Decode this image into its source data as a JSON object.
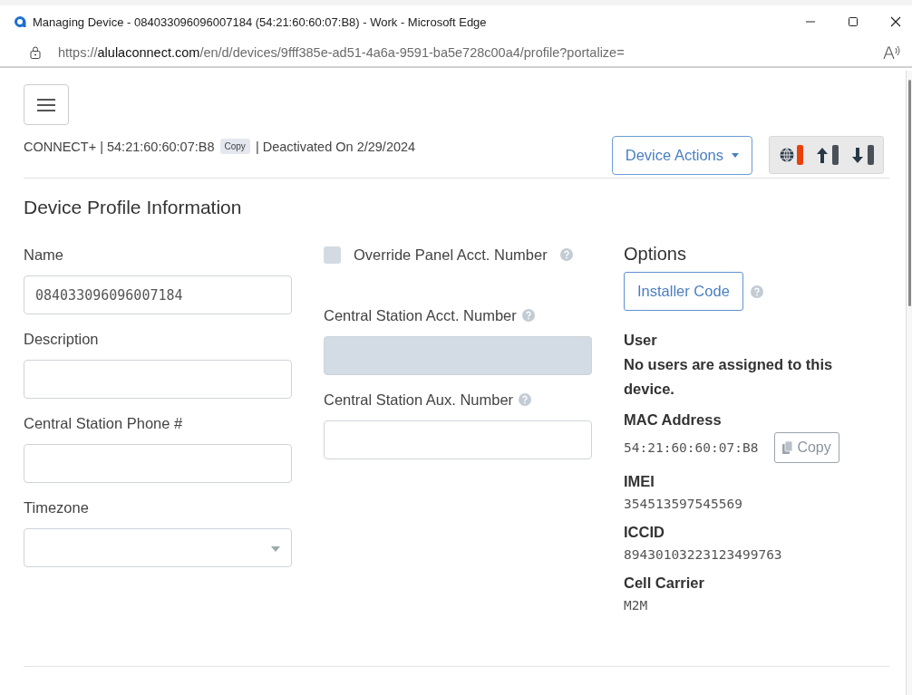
{
  "window": {
    "title": "Managing Device - 084033096096007184 (54:21:60:60:07:B8) - Work - Microsoft Edge"
  },
  "address_bar": {
    "url_parts": [
      {
        "text": "https://",
        "kind": "dim"
      },
      {
        "text": "alulaconnect.com",
        "kind": "host"
      },
      {
        "text": "/en/d/devices/9fff385e-ad51-4a6a-9591-ba5e728c00a4/profile?portalize=",
        "kind": "dim"
      }
    ]
  },
  "header": {
    "model": "CONNECT+ | 54:21:60:60:07:B8",
    "copy_label": "Copy",
    "status": "| Deactivated On 2/29/2024",
    "actions_button": "Device Actions",
    "indicators": [
      {
        "kind": "globe",
        "color": "#e8410a"
      },
      {
        "kind": "up",
        "color": "#4a5058"
      },
      {
        "kind": "down",
        "color": "#4a5058"
      }
    ]
  },
  "section_title": "Device Profile Information",
  "left_fields": [
    {
      "kind": "text",
      "label": "Name",
      "value": "084033096096007184"
    },
    {
      "kind": "text",
      "label": "Description"
    },
    {
      "kind": "text",
      "label": "Central Station Phone #"
    },
    {
      "kind": "select",
      "label": "Timezone"
    }
  ],
  "middle_fields": [
    {
      "kind": "checkbox",
      "label": "Override Panel Acct. Number",
      "checked": false,
      "help": true
    },
    {
      "kind": "text",
      "label": "Central Station Acct. Number",
      "disabled": true,
      "help": true
    },
    {
      "kind": "text",
      "label": "Central Station Aux. Number",
      "disabled": false,
      "help": true
    }
  ],
  "options": {
    "title": "Options",
    "installer_button": "Installer Code",
    "details": [
      {
        "label": "User",
        "value": "No users are assigned to this device.",
        "kind": "bold"
      },
      {
        "label": "MAC Address",
        "value": "54:21:60:60:07:B8",
        "kind": "mono",
        "copy_button": "Copy"
      },
      {
        "label": "IMEI",
        "value": "354513597545569",
        "kind": "mono"
      },
      {
        "label": "ICCID",
        "value": "89430103223123499763",
        "kind": "mono"
      },
      {
        "label": "Cell Carrier",
        "value": "M2M",
        "kind": "mono"
      }
    ]
  }
}
